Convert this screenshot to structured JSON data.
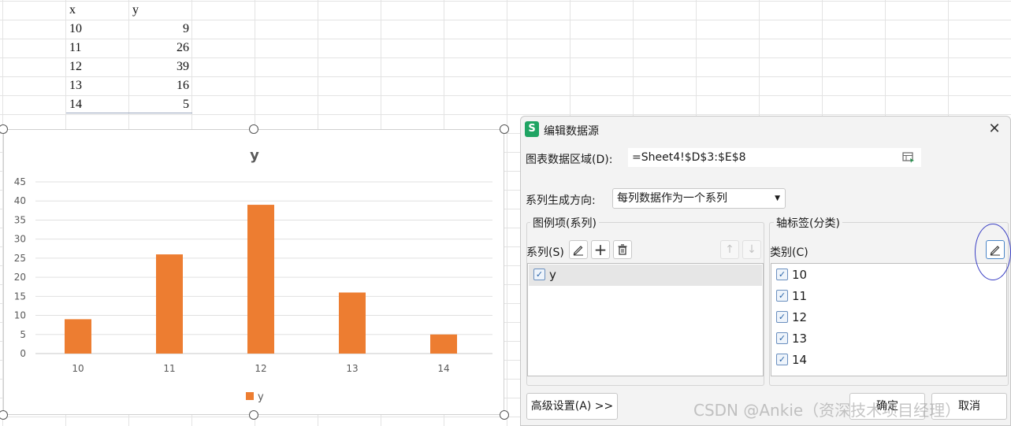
{
  "sheet": {
    "header": {
      "x": "x",
      "y": "y"
    },
    "rows": [
      {
        "x": "10",
        "y": "9"
      },
      {
        "x": "11",
        "y": "26"
      },
      {
        "x": "12",
        "y": "39"
      },
      {
        "x": "13",
        "y": "16"
      },
      {
        "x": "14",
        "y": "5"
      }
    ]
  },
  "chart_data": {
    "type": "bar",
    "title": "y",
    "categories": [
      "10",
      "11",
      "12",
      "13",
      "14"
    ],
    "series": [
      {
        "name": "y",
        "values": [
          9,
          26,
          39,
          16,
          5
        ],
        "color": "#ed7d31"
      }
    ],
    "ylim": [
      0,
      45
    ],
    "yticks": [
      "0",
      "5",
      "10",
      "15",
      "20",
      "25",
      "30",
      "35",
      "40",
      "45"
    ],
    "grid": true,
    "legend": "bottom"
  },
  "dialog": {
    "app_icon": "S",
    "title": "编辑数据源",
    "close_icon": "close-icon",
    "range_label": "图表数据区域(D):",
    "range_value": "=Sheet4!$D$3:$E$8",
    "direction_label": "系列生成方向:",
    "direction_value": "每列数据作为一个系列",
    "legend_group_title": "图例项(系列)",
    "series_label": "系列(S)",
    "series_items": [
      {
        "label": "y",
        "checked": true
      }
    ],
    "axis_group_title": "轴标签(分类)",
    "category_label": "类别(C)",
    "category_items": [
      {
        "label": "10",
        "checked": true
      },
      {
        "label": "11",
        "checked": true
      },
      {
        "label": "12",
        "checked": true
      },
      {
        "label": "13",
        "checked": true
      },
      {
        "label": "14",
        "checked": true
      }
    ],
    "advanced_button": "高级设置(A) >>",
    "ok_button": "确定",
    "cancel_button": "取消",
    "accent": "#1fa463"
  },
  "watermark": "CSDN @Ankie（资深技术项目经理）"
}
